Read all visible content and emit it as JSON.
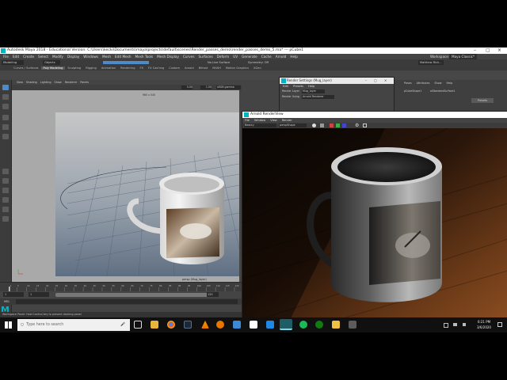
{
  "window": {
    "app_icon": "maya-icon",
    "title": "Autodesk Maya 2018 - Educational Version: C:\\Users\\kecki\\Documents\\maya\\projects\\default\\scenes\\Render_passes_demo\\render_passes_demo_5.ma*  ---  pCube1",
    "workspace_label": "Workspace:",
    "workspace_value": "Maya Classic*"
  },
  "menus": [
    "File",
    "Edit",
    "Create",
    "Select",
    "Modify",
    "Display",
    "Windows",
    "Mesh",
    "Edit Mesh",
    "Mesh Tools",
    "Mesh Display",
    "Curves",
    "Surfaces",
    "Deform",
    "UV",
    "Generate",
    "Cache",
    "Arnold",
    "Help"
  ],
  "statusline": {
    "mode": "Modeling",
    "objects_label": "Objects",
    "live_surface": "No Live Surface",
    "symmetry": "Symmetry: Off",
    "account": "Matthew Rick..."
  },
  "shelf_tabs": [
    "Curves / Surfaces",
    "Poly Modeling",
    "Sculpting",
    "Rigging",
    "Animation",
    "Rendering",
    "FX",
    "FX Caching",
    "Custom",
    "Arnold",
    "Bifrost",
    "MASH",
    "Motion Graphics",
    "XGen"
  ],
  "shelf_active": "Poly Modeling",
  "viewport": {
    "menus": [
      "View",
      "Shading",
      "Lighting",
      "Show",
      "Renderer",
      "Panels"
    ],
    "resolution": "960 x 540",
    "camera_label": "persp (Mug_layer)",
    "gamma": "sRGB gamma",
    "values": [
      "0.00",
      "1.00"
    ]
  },
  "timeline": {
    "ticks": [
      "1",
      "5",
      "10",
      "15",
      "20",
      "25",
      "30",
      "35",
      "40",
      "45",
      "50",
      "55",
      "60",
      "65",
      "70",
      "75",
      "80",
      "85",
      "90",
      "95",
      "100",
      "105",
      "110",
      "115",
      "120"
    ],
    "range_start": "1",
    "range_start2": "1",
    "range_end": "120",
    "mel": "MEL",
    "help": "Workspace Panel: Hold Control key to prevent docking panel"
  },
  "render_settings": {
    "title": "Render Settings (Mug_layer)",
    "menus": [
      "Edit",
      "Presets",
      "Help"
    ],
    "render_layer_label": "Render Layer",
    "render_layer": "Mug_layer",
    "render_using_label": "Render Using",
    "render_using": "Arnold Renderer"
  },
  "outliner": {
    "tabs": [
      "Poses",
      "Attributes",
      "Show",
      "Help"
    ],
    "items": [
      "pCubeShape1",
      "aiStandardSurface1"
    ],
    "button": "Presets"
  },
  "arnold_view": {
    "title": "Arnold RenderView",
    "menus": [
      "File",
      "Window",
      "View",
      "Render"
    ],
    "aov": "Beauty",
    "camera": "perspShape"
  },
  "taskbar": {
    "search_placeholder": "Type here to search",
    "time": "6:21 PM",
    "date": "3/6/2020"
  },
  "colors": {
    "maya_accent": "#00b4c8",
    "shelf_blue": "#4d8ac9",
    "shelf_orange": "#e07a1f",
    "taskbar": "#101010"
  }
}
